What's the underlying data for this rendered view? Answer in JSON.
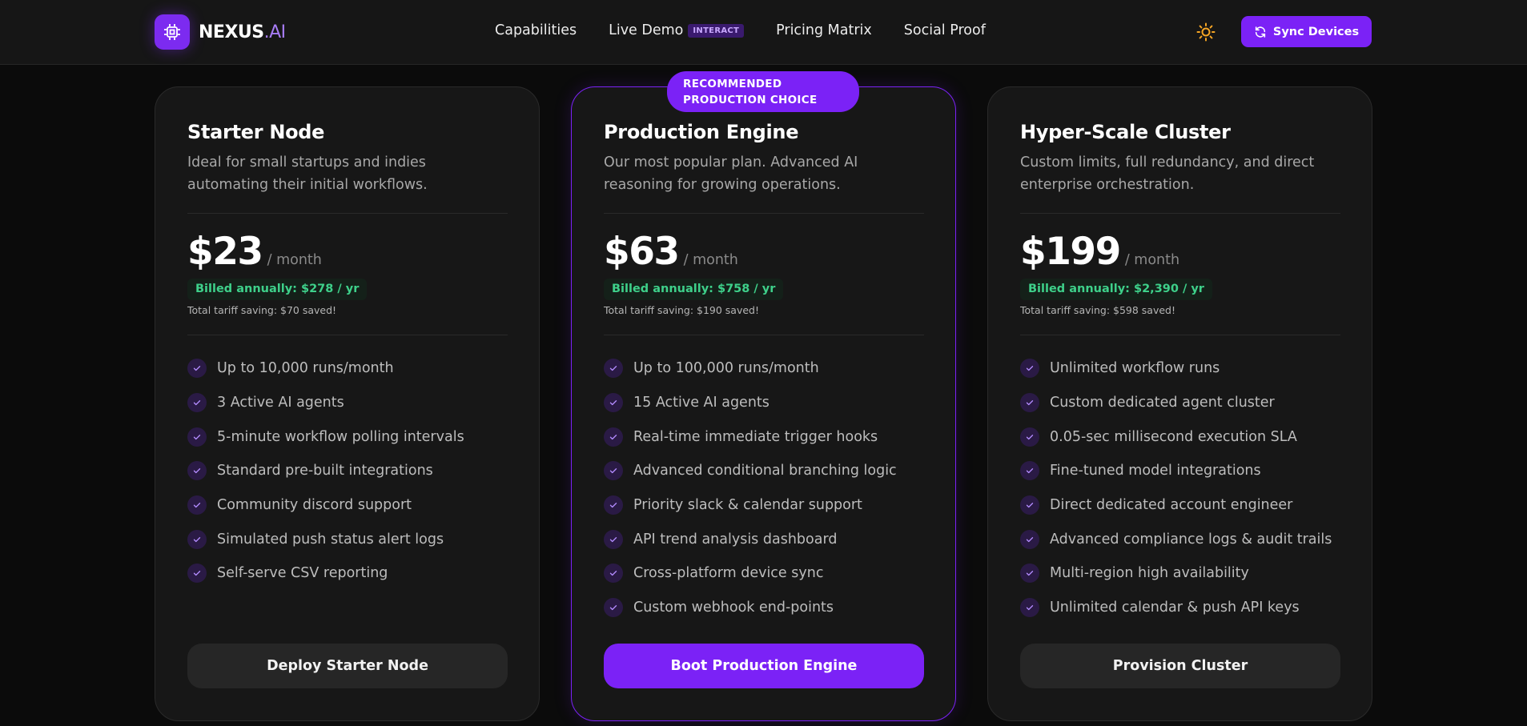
{
  "header": {
    "logo_name": "NEXUS",
    "logo_suffix": ".AI",
    "nav": [
      {
        "label": "Capabilities"
      },
      {
        "label": "Live Demo",
        "badge": "INTERACT"
      },
      {
        "label": "Pricing Matrix"
      },
      {
        "label": "Social Proof"
      }
    ],
    "theme_icon": "sun-icon",
    "sync_label": "Sync Devices"
  },
  "ribbon": "RECOMMENDED\nPRODUCTION CHOICE",
  "plans": [
    {
      "title": "Starter Node",
      "desc": "Ideal for small startups and indies automating their initial workflows.",
      "price": "$23",
      "period": "/ month",
      "billed": "Billed annually: $278 / yr",
      "saving": "Total tariff saving: $70 saved!",
      "features": [
        "Up to 10,000 runs/month",
        "3 Active AI agents",
        "5-minute workflow polling intervals",
        "Standard pre-built integrations",
        "Community discord support",
        "Simulated push status alert logs",
        "Self-serve CSV reporting"
      ],
      "cta": "Deploy Starter Node"
    },
    {
      "title": "Production Engine",
      "desc": "Our most popular plan. Advanced AI reasoning for growing operations.",
      "price": "$63",
      "period": "/ month",
      "billed": "Billed annually: $758 / yr",
      "saving": "Total tariff saving: $190 saved!",
      "features": [
        "Up to 100,000 runs/month",
        "15 Active AI agents",
        "Real-time immediate trigger hooks",
        "Advanced conditional branching logic",
        "Priority slack & calendar support",
        "API trend analysis dashboard",
        "Cross-platform device sync",
        "Custom webhook end-points"
      ],
      "cta": "Boot Production Engine"
    },
    {
      "title": "Hyper-Scale Cluster",
      "desc": "Custom limits, full redundancy, and direct enterprise orchestration.",
      "price": "$199",
      "period": "/ month",
      "billed": "Billed annually: $2,390 / yr",
      "saving": "Total tariff saving: $598 saved!",
      "features": [
        "Unlimited workflow runs",
        "Custom dedicated agent cluster",
        "0.05-sec millisecond execution SLA",
        "Fine-tuned model integrations",
        "Direct dedicated account engineer",
        "Advanced compliance logs & audit trails",
        "Multi-region high availability",
        "Unlimited calendar & push API keys"
      ],
      "cta": "Provision Cluster"
    }
  ],
  "colors": {
    "accent": "#7b22f6",
    "billed_text": "#3ed08a",
    "sun": "#f5a524"
  }
}
